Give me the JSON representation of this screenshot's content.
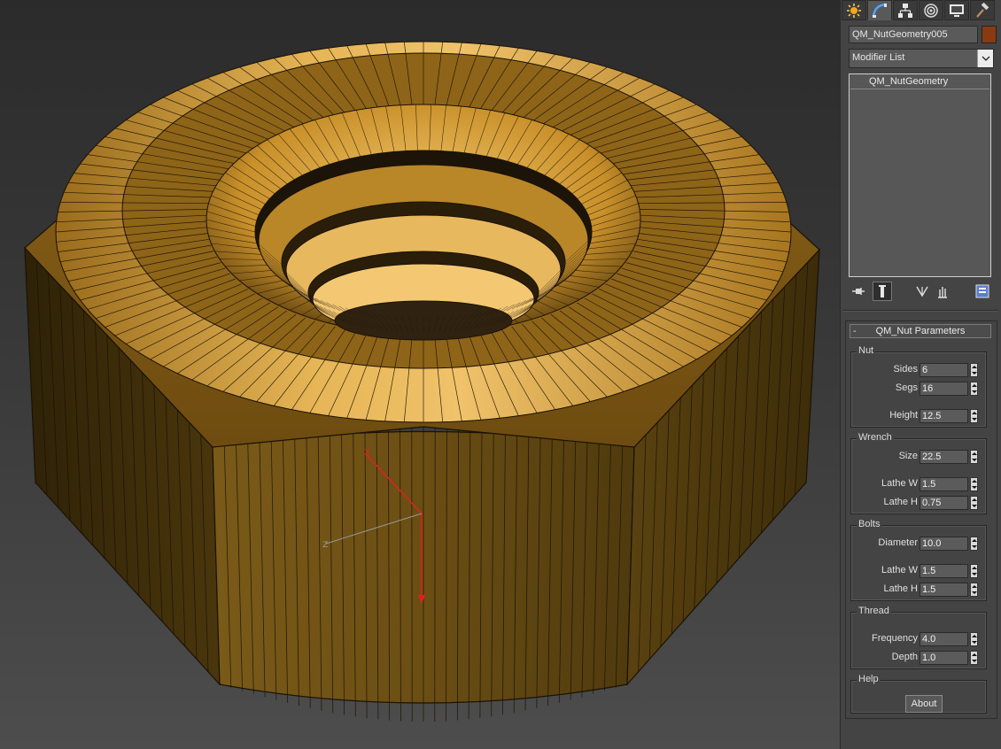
{
  "viewport": {
    "gizmo_axes": {
      "x": "X",
      "z": "Z"
    },
    "colors": {
      "nut_top": "#c9902a",
      "nut_side": "#5c4310",
      "edge": "#1a1206",
      "gizmo_red": "#e02020",
      "gizmo_gray": "#9a9a9a"
    }
  },
  "command_panel": {
    "tabs": [
      {
        "name": "create",
        "icon": "create-star-icon",
        "active": false
      },
      {
        "name": "modify",
        "icon": "modify-arc-icon",
        "active": true
      },
      {
        "name": "hierarchy",
        "icon": "hierarchy-icon",
        "active": false
      },
      {
        "name": "motion",
        "icon": "motion-icon",
        "active": false
      },
      {
        "name": "display",
        "icon": "display-monitor-icon",
        "active": false
      },
      {
        "name": "utilities",
        "icon": "utilities-hammer-icon",
        "active": false
      }
    ],
    "object_name": "QM_NutGeometry005",
    "object_color": "#8a3a12",
    "modifier_list_label": "Modifier List",
    "stack_items": [
      "QM_NutGeometry"
    ],
    "stack_tools": [
      "pin-stack-icon",
      "show-end-result-icon",
      "make-unique-icon",
      "remove-modifier-icon",
      "configure-modifier-sets-icon"
    ]
  },
  "rollout": {
    "collapse_symbol": "-",
    "title": "QM_Nut Parameters",
    "groups": {
      "nut": {
        "title": "Nut",
        "params": [
          {
            "label": "Sides",
            "value": "6"
          },
          {
            "label": "Segs",
            "value": "16"
          },
          {
            "label": "Height",
            "value": "12.5"
          }
        ]
      },
      "wrench": {
        "title": "Wrench",
        "params": [
          {
            "label": "Size",
            "value": "22.5"
          },
          {
            "label": "Lathe W",
            "value": "1.5"
          },
          {
            "label": "Lathe H",
            "value": "0.75"
          }
        ]
      },
      "bolts": {
        "title": "Bolts",
        "params": [
          {
            "label": "Diameter",
            "value": "10.0"
          },
          {
            "label": "Lathe W",
            "value": "1.5"
          },
          {
            "label": "Lathe H",
            "value": "1.5"
          }
        ]
      },
      "thread": {
        "title": "Thread",
        "params": [
          {
            "label": "Frequency",
            "value": "4.0"
          },
          {
            "label": "Depth",
            "value": "1.0"
          }
        ]
      },
      "help": {
        "title": "Help",
        "about_label": "About"
      }
    }
  }
}
